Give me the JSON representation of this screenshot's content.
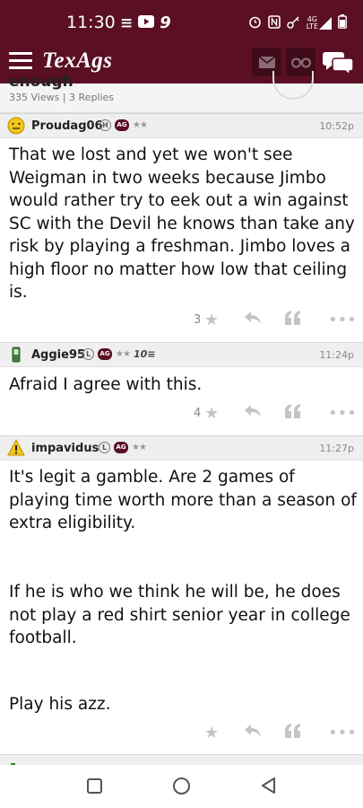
{
  "status_bar": {
    "time": "11:30",
    "left_icons": [
      "equals-icon",
      "youtube-icon",
      "nine-icon"
    ],
    "right_icons": [
      "alarm-icon",
      "nfc-icon",
      "key-icon",
      "signal-4g-icon",
      "battery-icon"
    ],
    "network_label_top": "4G",
    "network_label_bottom": "LTE"
  },
  "app_bar": {
    "logo": "TexAgs",
    "brand_color": "#5a0f24"
  },
  "thread": {
    "title_partial": "enough",
    "stats": "335 Views | 3 Replies"
  },
  "posts": [
    {
      "username": "Proudag06",
      "badge_letter": "H",
      "badge_ag": "AG",
      "stars": "★★",
      "time": "10:52p",
      "body": [
        "That we lost and yet we won't see Weigman in two weeks because Jimbo would rather try to eek out a win against SC with the Devil he knows than take any risk by playing a freshman. Jimbo loves a high floor no matter how low that ceiling is."
      ],
      "star_count": "3"
    },
    {
      "username": "Aggie95",
      "badge_letter": "L",
      "badge_ag": "AG",
      "stars": "★★",
      "extra_badge": "10≡",
      "time": "11:24p",
      "body": [
        "Afraid I agree with this."
      ],
      "star_count": "4"
    },
    {
      "username": "impavidus",
      "badge_letter": "L",
      "badge_ag": "AG",
      "stars": "★★",
      "time": "11:27p",
      "body": [
        "It's legit a gamble. Are 2 games of playing time worth more than a season of extra eligibility.",
        "If he is who we think he will be, he does not play a red shirt senior year in college football.",
        "Play his azz."
      ],
      "star_count": ""
    }
  ]
}
